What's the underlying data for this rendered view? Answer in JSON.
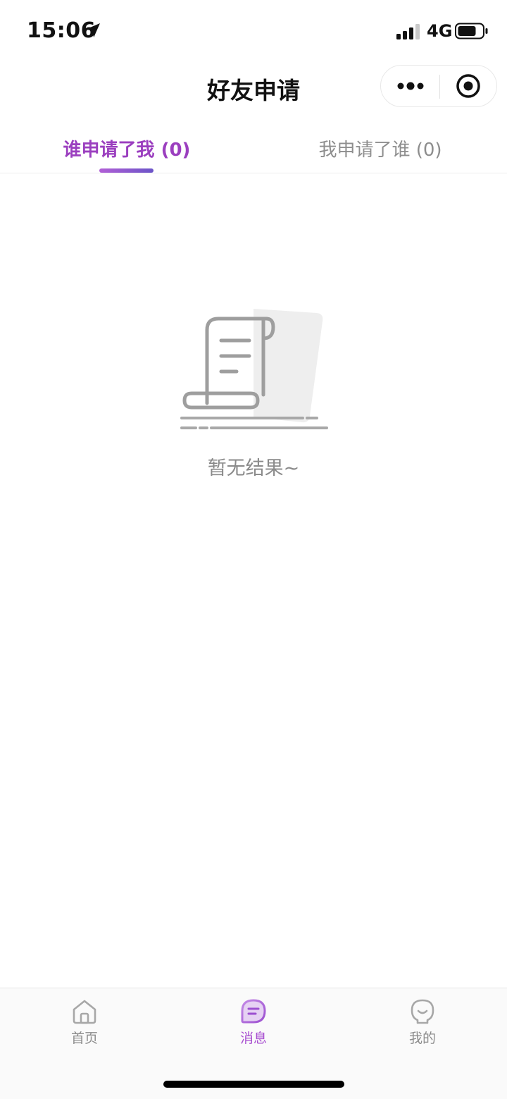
{
  "status_bar": {
    "time": "15:06",
    "network": "4G"
  },
  "nav": {
    "title": "好友申请"
  },
  "tabs": [
    {
      "label": "谁申请了我 (0)",
      "active": true
    },
    {
      "label": "我申请了谁 (0)",
      "active": false
    }
  ],
  "empty_state": {
    "message": "暂无结果~"
  },
  "tab_bar": {
    "items": [
      {
        "label": "首页",
        "icon": "home-icon",
        "active": false
      },
      {
        "label": "消息",
        "icon": "message-icon",
        "active": true
      },
      {
        "label": "我的",
        "icon": "profile-icon",
        "active": false
      }
    ]
  },
  "colors": {
    "accent": "#9b3fbf",
    "inactive_text": "#8e8e8e",
    "empty_text": "#8a8a8a"
  }
}
